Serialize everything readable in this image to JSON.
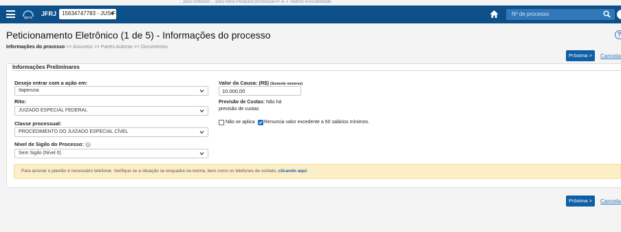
{
  "header": {
    "org": "JFRJ",
    "logo_text": "eproc",
    "process_selector": "15634747783 - JUS F",
    "search_placeholder": "Nº de processo",
    "top_strip": "... para conteúdo  ... para menu  Pesquisa processual  A+  A-  ◐  Atalhos  Acessibilidade"
  },
  "page": {
    "title": "Peticionamento Eletrônico (1 de 5) - Informações do processo",
    "help": "?",
    "breadcrumb": {
      "current": "Informações do processo",
      "rest": " >> Assuntos >> Partes Autoras >> Documentos"
    },
    "next_label": "Próxima >",
    "cancel_label": "Cancelar"
  },
  "form": {
    "section_title": "Informações Preliminares",
    "acao": {
      "label": "Desejo entrar com a ação em:",
      "value": "Itaperuna"
    },
    "rito": {
      "label": "Rito:",
      "value": "JUIZADO ESPECIAL FEDERAL"
    },
    "classe": {
      "label": "Classe processual:",
      "value": "PROCEDIMENTO DO JUIZADO ESPECIAL CÍVEL"
    },
    "sigilo": {
      "label": "Nível de Sigilo do Processo:",
      "value": "Sem Sigilo (Nível 0)"
    },
    "valor_causa": {
      "label": "Valor da Causa: (R$)",
      "hint": "(Somente números)",
      "value": "10.000,00"
    },
    "previsao": {
      "label": "Previsão de Custas:",
      "value_line1": "Não há",
      "value_line2": "previsão de custas"
    },
    "nao_se_aplica": {
      "label": "Não se aplica",
      "checked": false
    },
    "renuncia": {
      "label": "Renuncia valor excedente a 60 salários mínimos.",
      "checked": true
    },
    "alert": {
      "text": "Para acionar o plantão é necessário telefonar. Verifique se a situação se enquadra na norma, bem como os telefones de contato,",
      "link": "clicando aqui"
    }
  },
  "colors": {
    "header_bg": "#0d4f88",
    "primary_button": "#0d5fa6",
    "alert_bg": "#fcefc7",
    "link": "#2a77c0"
  }
}
